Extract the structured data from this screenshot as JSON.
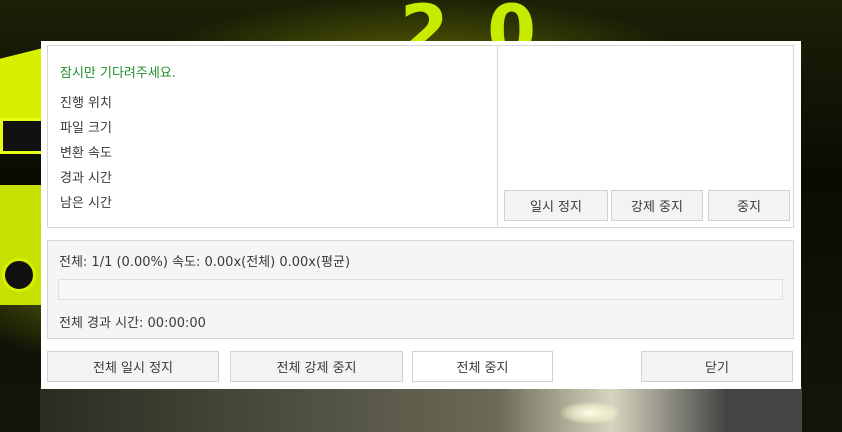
{
  "info": {
    "wait_message": "잠시만 기다려주세요.",
    "labels": [
      "진행 위치",
      "파일 크기",
      "변환 속도",
      "경과 시간",
      "남은 시간"
    ]
  },
  "file_buttons": {
    "pause": "일시 정지",
    "force_stop": "강제 중지",
    "stop": "중지"
  },
  "total": {
    "status": "전체: 1/1 (0.00%) 속도: 0.00x(전체) 0.00x(평균)",
    "progress_fraction": 0.0,
    "elapsed": "전체 경과 시간: 00:00:00"
  },
  "bottom_buttons": {
    "pause_all": "전체 일시 정지",
    "force_stop_all": "전체 강제 중지",
    "stop_all": "전체 중지",
    "close": "닫기"
  },
  "colors": {
    "wait_text": "#1f8f2b",
    "background_accent": "#d8f000"
  }
}
